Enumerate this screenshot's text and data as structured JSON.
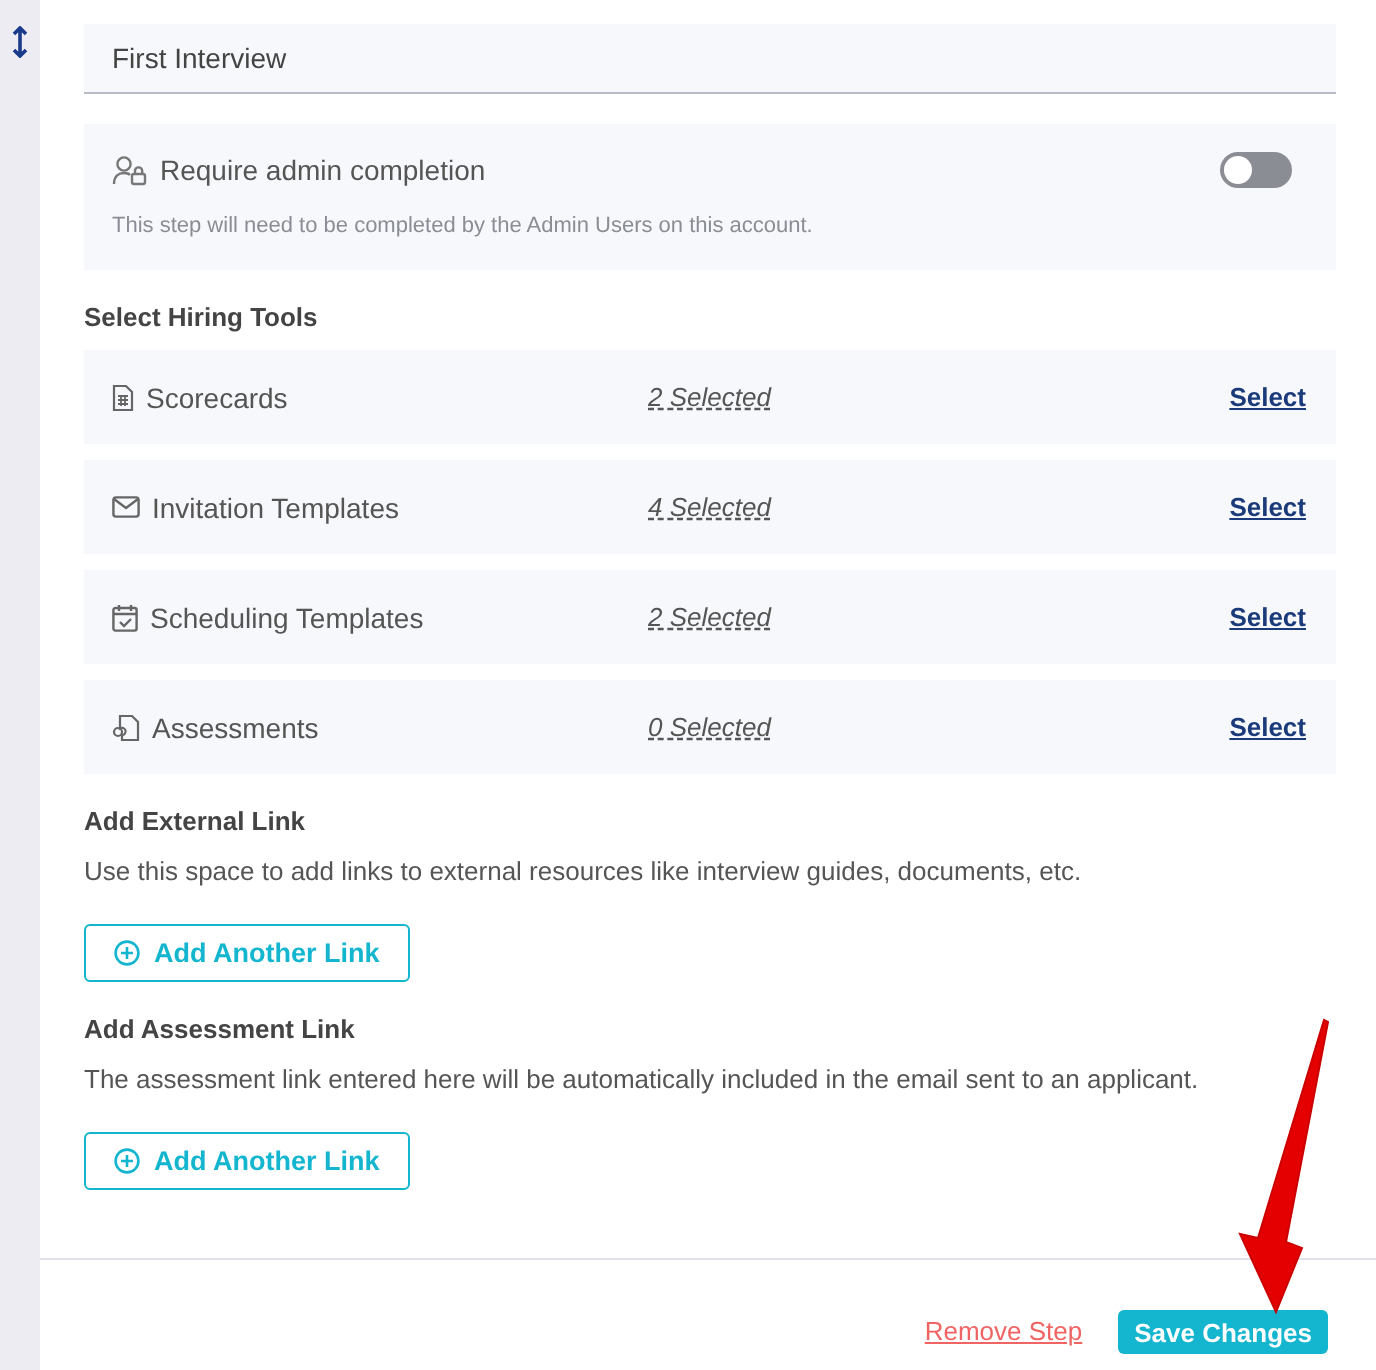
{
  "step_name_field": {
    "value": "First Interview"
  },
  "admin_completion": {
    "label": "Require admin completion",
    "description": "This step will need to be completed by the Admin Users on this account.",
    "on": false
  },
  "hiring_tools": {
    "heading": "Select Hiring Tools",
    "rows": [
      {
        "kind": "scorecard",
        "name": "Scorecards",
        "count": "2 Selected",
        "action": "Select"
      },
      {
        "kind": "envelope",
        "name": "Invitation Templates",
        "count": "4 Selected",
        "action": "Select"
      },
      {
        "kind": "calendar",
        "name": "Scheduling Templates",
        "count": "2 Selected",
        "action": "Select"
      },
      {
        "kind": "puzzle",
        "name": "Assessments",
        "count": "0 Selected",
        "action": "Select"
      }
    ]
  },
  "external_link": {
    "heading": "Add External Link",
    "description": "Use this space to add links to external resources like interview guides, documents, etc.",
    "button": "Add Another Link"
  },
  "assessment_link": {
    "heading": "Add Assessment Link",
    "description": "The assessment link entered here will be automatically included in the email sent to an applicant.",
    "button": "Add Another Link"
  },
  "footer": {
    "remove": "Remove Step",
    "save": "Save Changes"
  }
}
